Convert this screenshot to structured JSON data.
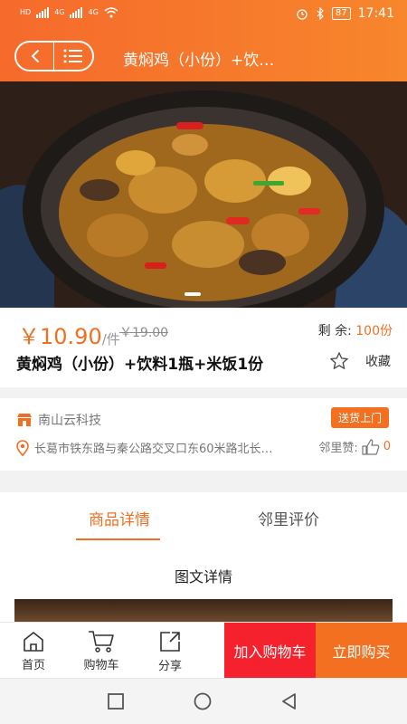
{
  "status": {
    "left_tags": [
      "HD",
      "4G",
      "4G"
    ],
    "battery": "87",
    "time": "17:41"
  },
  "header": {
    "title": "黄焖鸡（小份）+饮…"
  },
  "product": {
    "currency": "￥",
    "price": "10.90",
    "unit": "/件",
    "original_price": "￥19.00",
    "remain_label": "剩  余:",
    "remain_value": "100份",
    "name": "黄焖鸡（小份）+饮料1瓶+米饭1份",
    "favorite_label": "收藏"
  },
  "store": {
    "name": "南山云科技",
    "delivery_badge": "送货上门",
    "address": "长葛市铁东路与秦公路交叉口东60米路北长…",
    "likes_label": "邻里赞:",
    "likes_count": "0"
  },
  "tabs": [
    {
      "label": "商品详情",
      "active": true
    },
    {
      "label": "邻里评价",
      "active": false
    }
  ],
  "details": {
    "section_title": "图文详情"
  },
  "actionbar": {
    "home": "首页",
    "cart": "购物车",
    "share": "分享",
    "add_to_cart": "加入购物车",
    "buy_now": "立即购买"
  },
  "colors": {
    "accent": "#f07023",
    "cart_red": "#f5222d"
  }
}
